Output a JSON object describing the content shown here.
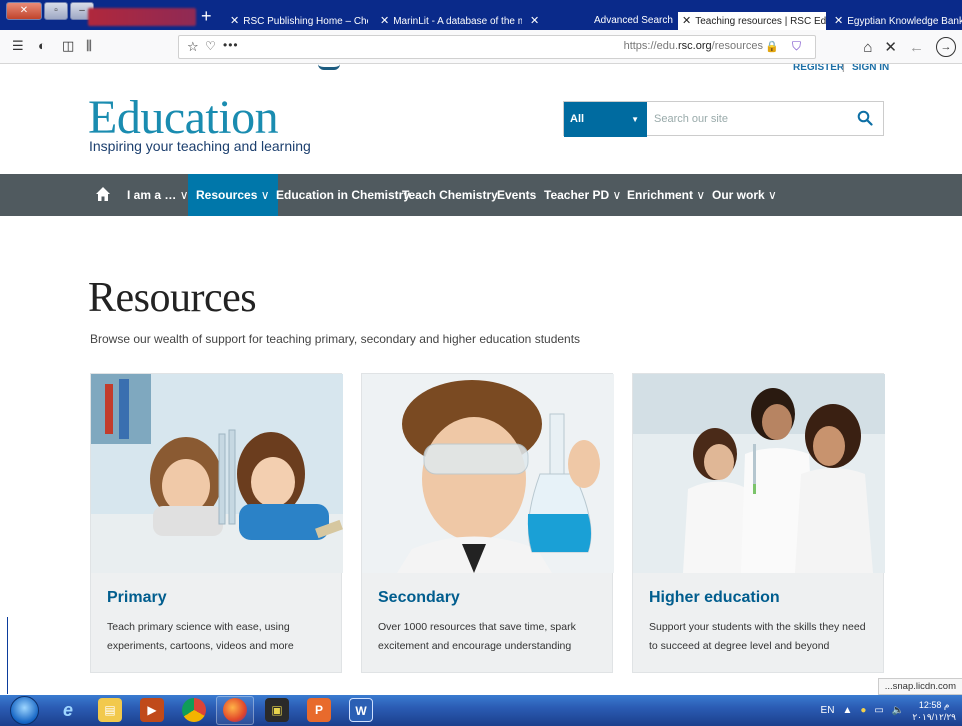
{
  "browser": {
    "tabs": [
      {
        "label": "RSC Publishing Home – Chem"
      },
      {
        "label": "MarinLit - A database of the m"
      },
      {
        "label": ""
      },
      {
        "label": "Advanced Search"
      },
      {
        "label": "Teaching resources | RSC Educ",
        "active": true
      },
      {
        "label": "Egyptian Knowledge Bank - Sc"
      }
    ],
    "new_tab_label": "+",
    "url_prefix": "https://edu.",
    "url_domain": "rsc.org",
    "url_path": "/resources",
    "page_actions": "•••"
  },
  "site": {
    "top_links": {
      "register": "REGISTER",
      "sign_in": "SIGN IN"
    },
    "logo_text": "Education",
    "tagline": "Inspiring your teaching and learning",
    "search": {
      "scope": "All",
      "placeholder": "Search our site"
    },
    "nav": {
      "i_am": "I am a …",
      "resources": "Resources",
      "eic": "Education in Chemistry",
      "teach": "Teach Chemistry",
      "events": "Events",
      "teacher_pd": "Teacher PD",
      "enrichment": "Enrichment",
      "our_work": "Our work",
      "chevron": "∨"
    },
    "heading": "Resources",
    "lead": "Browse our wealth of support for teaching primary, secondary and higher education students",
    "cards": [
      {
        "title": "Primary",
        "desc": "Teach primary science with ease, using experiments, cartoons, videos and more"
      },
      {
        "title": "Secondary",
        "desc": "Over 1000 resources that save time, spark excitement and encourage understanding"
      },
      {
        "title": "Higher education",
        "desc": "Support your students with the skills they need to succeed at degree level and beyond"
      }
    ]
  },
  "status_url": "...snap.licdn.com",
  "tray": {
    "lang": "EN",
    "time": "12:58 م",
    "date": "٢٠١٩/١٢/٢٩"
  },
  "colors": {
    "brand": "#1a8cb0",
    "nav_bg": "#505a5f",
    "nav_active": "#0077aa",
    "card_title": "#005d8e"
  }
}
